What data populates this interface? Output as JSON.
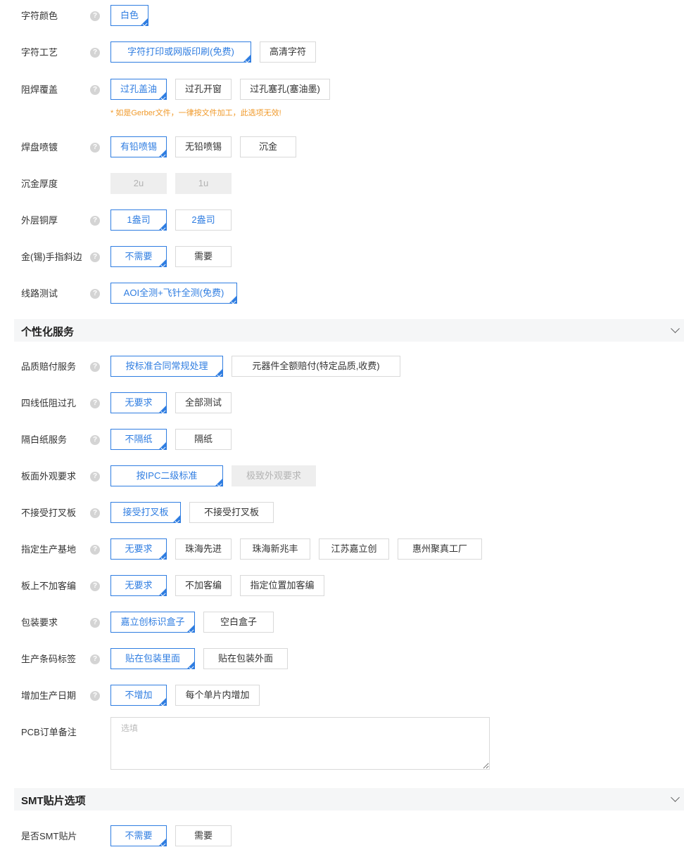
{
  "rows": [
    {
      "label": "字符颜色",
      "options": [
        "白色"
      ]
    },
    {
      "label": "字符工艺",
      "options": [
        "字符打印或网版印刷(免费)",
        "高清字符"
      ]
    },
    {
      "label": "阻焊覆盖",
      "options": [
        "过孔盖油",
        "过孔开窗",
        "过孔塞孔(塞油墨)"
      ],
      "note": "* 如是Gerber文件，一律按文件加工，此选项无效!"
    },
    {
      "label": "焊盘喷镀",
      "options": [
        "有铅喷锡",
        "无铅喷锡",
        "沉金"
      ]
    },
    {
      "label": "沉金厚度",
      "options": [
        "2u",
        "1u"
      ]
    },
    {
      "label": "外层铜厚",
      "options": [
        "1盎司",
        "2盎司"
      ]
    },
    {
      "label": "金(锡)手指斜边",
      "options": [
        "不需要",
        "需要"
      ]
    },
    {
      "label": "线路测试",
      "options": [
        "AOI全测+飞针全测(免费)"
      ]
    },
    {
      "label": "品质赔付服务",
      "options": [
        "按标准合同常规处理",
        "元器件全额赔付(特定品质,收费)"
      ]
    },
    {
      "label": "四线低阻过孔",
      "options": [
        "无要求",
        "全部测试"
      ]
    },
    {
      "label": "隔白纸服务",
      "options": [
        "不隔纸",
        "隔纸"
      ]
    },
    {
      "label": "板面外观要求",
      "options": [
        "按IPC二级标准",
        "极致外观要求"
      ]
    },
    {
      "label": "不接受打叉板",
      "options": [
        "接受打叉板",
        "不接受打叉板"
      ]
    },
    {
      "label": "指定生产基地",
      "options": [
        "无要求",
        "珠海先进",
        "珠海新兆丰",
        "江苏嘉立创",
        "惠州聚真工厂"
      ]
    },
    {
      "label": "板上不加客编",
      "options": [
        "无要求",
        "不加客编",
        "指定位置加客编"
      ]
    },
    {
      "label": "包装要求",
      "options": [
        "嘉立创标识盒子",
        "空白盒子"
      ]
    },
    {
      "label": "生产条码标签",
      "options": [
        "贴在包装里面",
        "贴在包装外面"
      ]
    },
    {
      "label": "增加生产日期",
      "options": [
        "不增加",
        "每个单片内增加"
      ]
    },
    {
      "label": "是否SMT贴片",
      "options": [
        "不需要",
        "需要"
      ]
    }
  ],
  "sections": [
    "个性化服务",
    "SMT贴片选项"
  ],
  "remark": {
    "label": "PCB订单备注",
    "placeholder": "选填"
  },
  "help_glyph": "?",
  "colors": {
    "accent": "#2f7de1",
    "note": "#f09a2b",
    "disabled_bg": "#eeeeee",
    "section_bg": "#f5f6f7"
  }
}
